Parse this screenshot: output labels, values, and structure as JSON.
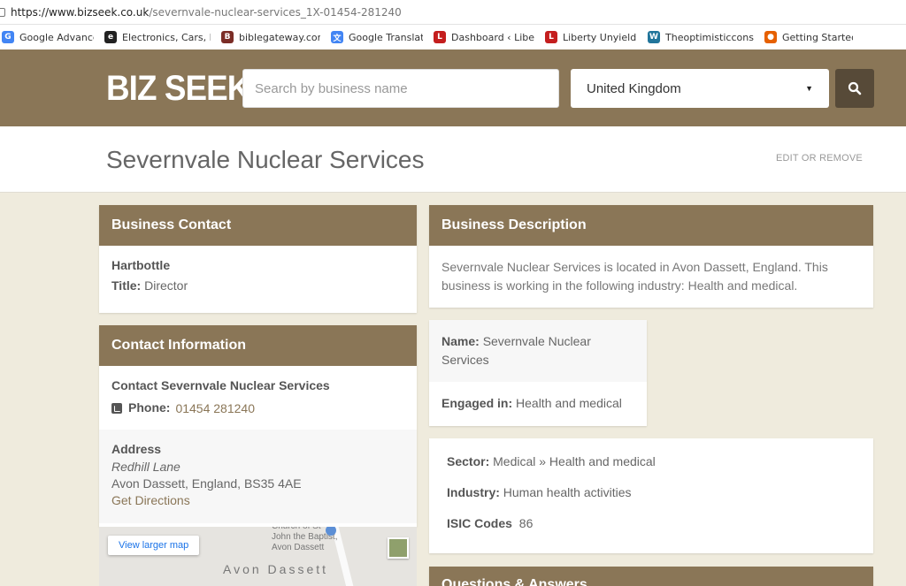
{
  "browser": {
    "url_host": "https://www.bizseek.co.uk",
    "url_path": "/severnvale-nuclear-services_1X-01454-281240",
    "bookmarks": [
      {
        "label": "Google Advanced Se",
        "icon": "google-icon",
        "color": "#4285f4",
        "glyph": "G"
      },
      {
        "label": "Electronics, Cars, Fas",
        "icon": "ebay-icon",
        "color": "#222222",
        "glyph": "e"
      },
      {
        "label": "biblegateway.com A",
        "icon": "biblegateway-icon",
        "color": "#7b2d26",
        "glyph": "B"
      },
      {
        "label": "Google Translate",
        "icon": "translate-icon",
        "color": "#4285f4",
        "glyph": "文"
      },
      {
        "label": "Dashboard ‹ Liberty",
        "icon": "liberty-icon",
        "color": "#c41e1e",
        "glyph": "L"
      },
      {
        "label": "Liberty Unyielding",
        "icon": "liberty-icon",
        "color": "#c41e1e",
        "glyph": "L"
      },
      {
        "label": "Theoptimisticconserv",
        "icon": "wordpress-icon",
        "color": "#21759b",
        "glyph": "W"
      },
      {
        "label": "Getting Started",
        "icon": "firefox-icon",
        "color": "#e66000",
        "glyph": "●"
      }
    ]
  },
  "header": {
    "logo": "BIZ SEEK",
    "search_placeholder": "Search by business name",
    "country": "United Kingdom"
  },
  "titlebar": {
    "title": "Severnvale Nuclear Services",
    "edit_link": "EDIT OR REMOVE"
  },
  "business_contact": {
    "heading": "Business Contact",
    "person": "Hartbottle",
    "title_label": "Title:",
    "title_value": "Director"
  },
  "contact_info": {
    "heading": "Contact Information",
    "contact_line": "Contact Severnvale Nuclear Services",
    "phone_label": "Phone:",
    "phone_value": "01454 281240",
    "address_heading": "Address",
    "street": "Redhill Lane",
    "city_line": "Avon Dassett, England, BS35 4AE",
    "directions": "Get Directions"
  },
  "map": {
    "view_larger": "View larger map",
    "church": "Church of St John the Baptist, Avon Dassett",
    "town": "Avon Dassett"
  },
  "business_description": {
    "heading": "Business Description",
    "text": "Severnvale Nuclear Services is located in Avon Dassett, England. This business is working in the following industry: Health and medical."
  },
  "name_box": {
    "name_label": "Name:",
    "name_value": "Severnvale Nuclear Services",
    "engaged_label": "Engaged in:",
    "engaged_value": "Health and medical"
  },
  "sector_box": {
    "sector_label": "Sector:",
    "sector_value": "Medical »  Health and medical",
    "industry_label": "Industry:",
    "industry_value": "Human health activities",
    "isic_label": "ISIC Codes",
    "isic_value": "86"
  },
  "qa": {
    "heading": "Questions & Answers"
  }
}
